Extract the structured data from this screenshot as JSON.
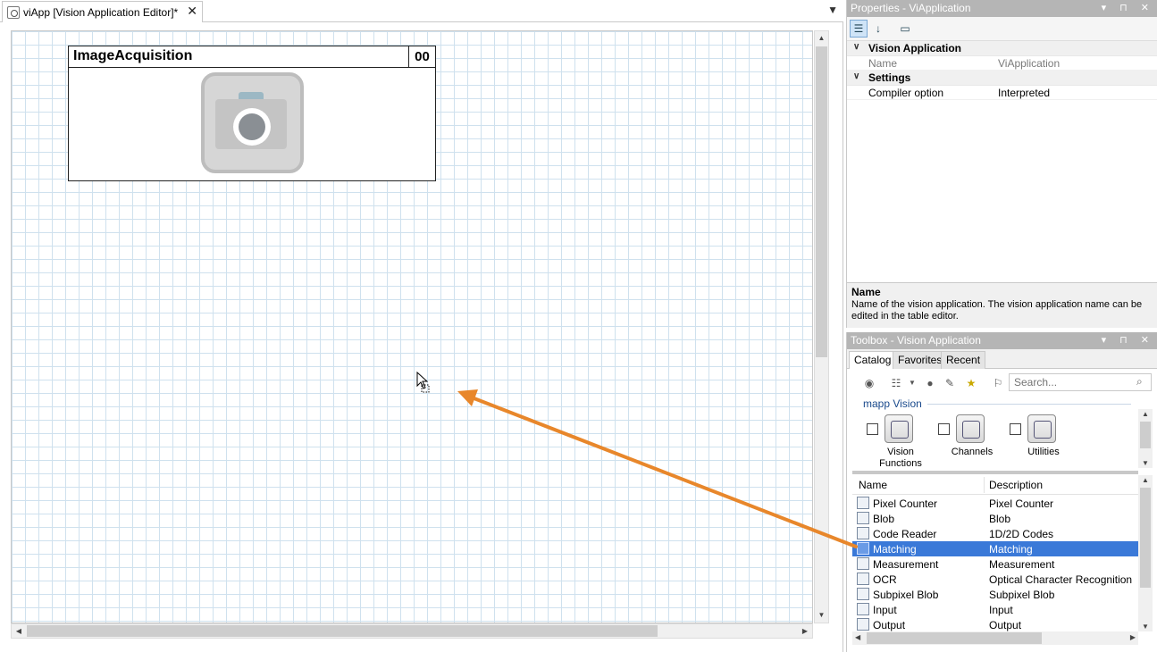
{
  "editor": {
    "tab_title": "viApp [Vision Application Editor]*",
    "tab_close": "✕",
    "tab_dropdown": "▼",
    "block": {
      "title": "ImageAcquisition",
      "id": "00",
      "icon": "camera-icon"
    }
  },
  "properties": {
    "title": "Properties - ViApplication",
    "controls": "▾ ⊓ ✕",
    "categories": [
      {
        "label": "Vision Application",
        "rows": [
          {
            "name": "Name",
            "value": "ViApplication"
          }
        ]
      },
      {
        "label": "Settings",
        "rows": [
          {
            "name": "Compiler option",
            "value": "Interpreted"
          }
        ]
      }
    ],
    "description": {
      "title": "Name",
      "text": "Name of the vision application. The vision application name can be edited in the table editor."
    }
  },
  "toolbox": {
    "title": "Toolbox - Vision Application",
    "controls": "▾ ⊓ ✕",
    "tabs": [
      "Catalog",
      "Favorites",
      "Recent"
    ],
    "search_placeholder": "Search...",
    "catalog_header": "mapp Vision",
    "catalog_items": [
      {
        "label": "Vision Functions"
      },
      {
        "label": "Channels"
      },
      {
        "label": "Utilities"
      }
    ],
    "list_headers": {
      "name": "Name",
      "description": "Description"
    },
    "functions": [
      {
        "name": "Pixel Counter",
        "description": "Pixel Counter"
      },
      {
        "name": "Blob",
        "description": "Blob"
      },
      {
        "name": "Code Reader",
        "description": "1D/2D Codes"
      },
      {
        "name": "Matching",
        "description": "Matching"
      },
      {
        "name": "Measurement",
        "description": "Measurement"
      },
      {
        "name": "OCR",
        "description": "Optical Character Recognition"
      },
      {
        "name": "Subpixel Blob",
        "description": "Subpixel Blob"
      },
      {
        "name": "Input",
        "description": "Input"
      },
      {
        "name": "Output",
        "description": "Output"
      }
    ],
    "selected_function": "Matching"
  },
  "colors": {
    "selection": "#3a79d8",
    "arrow": "#e8872b",
    "panel_title": "#b5b5b5",
    "grid": "#cfe1ee"
  }
}
